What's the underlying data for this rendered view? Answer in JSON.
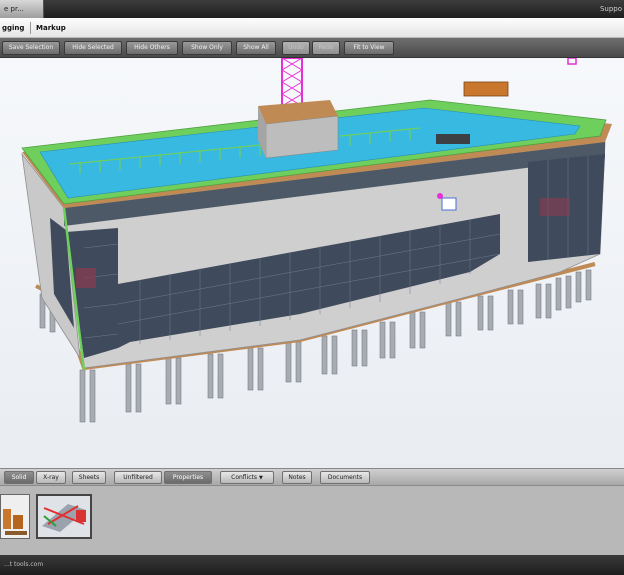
{
  "window": {
    "tab_title": "e pr...",
    "right_label": "Suppo"
  },
  "menubar": {
    "items": [
      "gging",
      "Markup"
    ]
  },
  "toolbar": {
    "buttons": [
      {
        "label": "Save Selection",
        "enabled": true
      },
      {
        "label": "Hide Selected",
        "enabled": true
      },
      {
        "label": "Hide Others",
        "enabled": true
      },
      {
        "label": "Show Only",
        "enabled": true
      },
      {
        "label": "Show All",
        "enabled": true
      },
      {
        "label": "Undo",
        "enabled": false
      },
      {
        "label": "Redo",
        "enabled": false
      },
      {
        "label": "Fit to View",
        "enabled": true
      }
    ]
  },
  "viewport": {
    "content": "3D BIM building model"
  },
  "bottom_tabs": {
    "items": [
      {
        "label": "Solid",
        "active": true
      },
      {
        "label": "X-ray",
        "active": false
      },
      {
        "label": "Sheets",
        "active": false
      },
      {
        "label": "Unfiltered",
        "active": false
      },
      {
        "label": "Properties",
        "active": true
      },
      {
        "label": "Conflicts",
        "active": false,
        "dropdown": true
      },
      {
        "label": "Notes",
        "active": false
      },
      {
        "label": "Documents",
        "active": false
      }
    ]
  },
  "status": {
    "text": "...t tools.com"
  },
  "colors": {
    "roof_water": "#37b9e2",
    "roof_edge": "#6fcf5c",
    "glass": "#3f4b5c",
    "wall": "#c9c9c9",
    "piles": "#a7acb2",
    "crane": "#e62fd6",
    "slab_wood": "#c08a55"
  }
}
